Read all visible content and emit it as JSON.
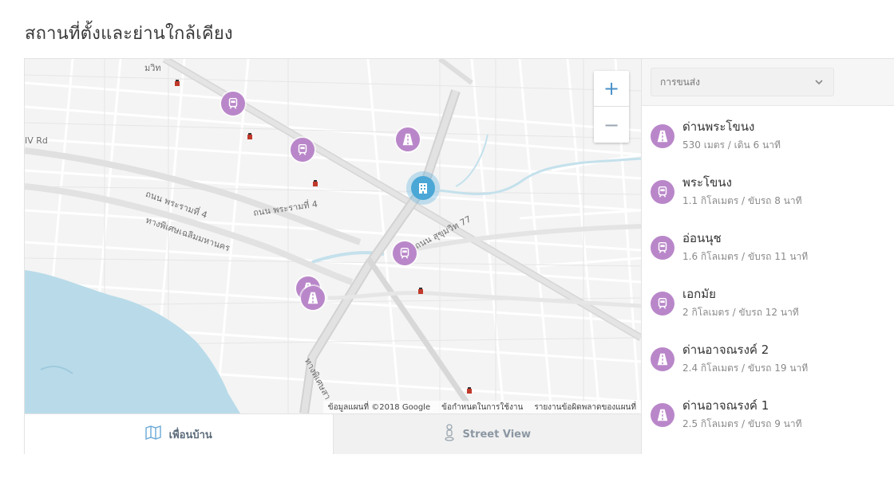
{
  "heading": "สถานที่ตั้งและย่านใกล้เคียง",
  "map": {
    "zoom_in": "+",
    "zoom_out": "−",
    "road_labels": {
      "rama4_a": "ถนน พระรามที่ 4",
      "rama4_b": "ถนน พระรามที่ 4",
      "expressway": "ทางพิเศษเฉลิมมหานคร",
      "sukhumvit": "ถนน สุขุมวิท 77",
      "rd": "IV Rd",
      "top_left": "มวิท",
      "bottom": "ทางพิเศษสา"
    },
    "attribution": {
      "data": "ข้อมูลแผนที่ ©2018 Google",
      "terms": "ข้อกำหนดในการใช้งาน",
      "report": "รายงานข้อผิดพลาดของแผนที่"
    },
    "pins": [
      {
        "type": "train-icon"
      },
      {
        "type": "train-icon"
      },
      {
        "type": "road-icon"
      },
      {
        "type": "train-icon"
      },
      {
        "type": "train-icon"
      },
      {
        "type": "road-icon"
      }
    ]
  },
  "tabs": {
    "neighborhood": "เพื่อนบ้าน",
    "street_view": "Street View"
  },
  "filter": {
    "selected": "การขนส่ง"
  },
  "places": [
    {
      "name": "ด่านพระโขนง",
      "distance": "530 เมตร / เดิน 6 นาที",
      "icon": "road-icon"
    },
    {
      "name": "พระโขนง",
      "distance": "1.1 กิโลเมตร / ขับรถ 8 นาที",
      "icon": "train-icon"
    },
    {
      "name": "อ่อนนุช",
      "distance": "1.6 กิโลเมตร / ขับรถ 11 นาที",
      "icon": "train-icon"
    },
    {
      "name": "เอกมัย",
      "distance": "2 กิโลเมตร / ขับรถ 12 นาที",
      "icon": "train-icon"
    },
    {
      "name": "ด่านอาจณรงค์ 2",
      "distance": "2.4 กิโลเมตร / ขับรถ 19 นาที",
      "icon": "road-icon"
    },
    {
      "name": "ด่านอาจณรงค์ 1",
      "distance": "2.5 กิโลเมตร / ขับรถ 9 นาที",
      "icon": "road-icon"
    }
  ],
  "colors": {
    "pin": "#b987c9",
    "hotel": "#4aa7d6",
    "water": "#b9dbe9"
  }
}
